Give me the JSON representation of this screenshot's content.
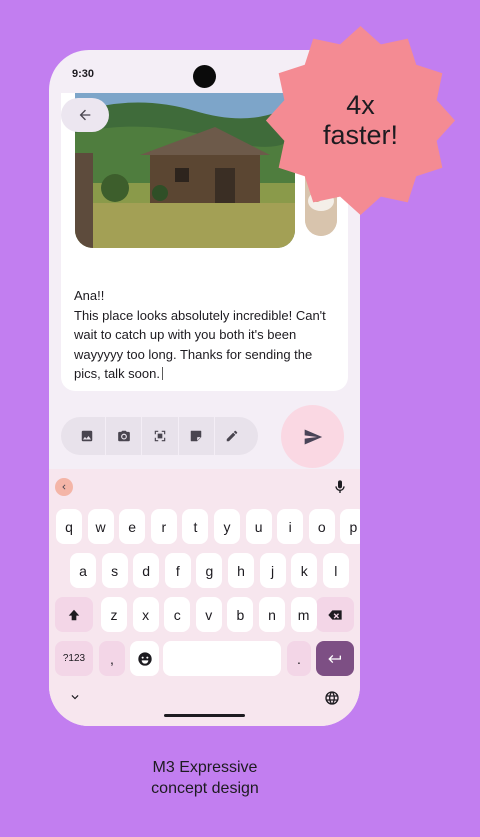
{
  "status": {
    "time": "9:30"
  },
  "message": {
    "lines": [
      "Ana!!",
      "This place looks absolutely incredible! Can't",
      "wait to catch up with you both it's been",
      "wayyyyy too long. Thanks for sending the",
      "pics, talk soon."
    ]
  },
  "toolbar": {
    "icons": [
      "image-icon",
      "camera-icon",
      "scan-icon",
      "sticker-icon",
      "handwriting-icon"
    ]
  },
  "keyboard": {
    "row1": [
      "q",
      "w",
      "e",
      "r",
      "t",
      "y",
      "u",
      "i",
      "o",
      "p"
    ],
    "row2": [
      "a",
      "s",
      "d",
      "f",
      "g",
      "h",
      "j",
      "k",
      "l"
    ],
    "row3": [
      "z",
      "x",
      "c",
      "v",
      "b",
      "n",
      "m"
    ],
    "symbols_label": "?123",
    "comma": ",",
    "period": "."
  },
  "badge": {
    "line1": "4x",
    "line2": "faster!",
    "color": "#f48b93"
  },
  "caption": {
    "line1": "M3 Expressive",
    "line2": "concept design"
  },
  "colors": {
    "background": "#c27ef0",
    "accent": "#7d4f84",
    "send": "#fad8e3"
  }
}
